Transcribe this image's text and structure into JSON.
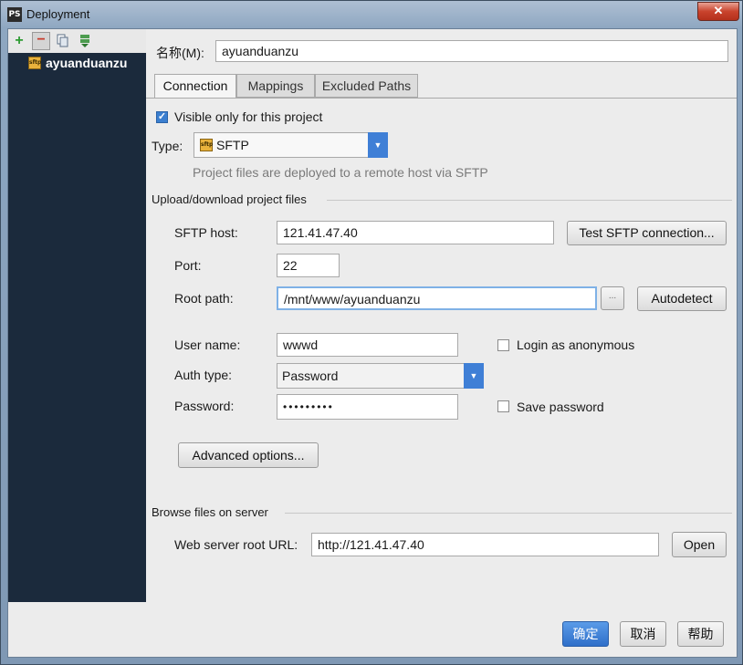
{
  "window": {
    "title": "Deployment",
    "app_icon": "PS",
    "close": "✕"
  },
  "sidebar": {
    "toolbar": {
      "add": "+",
      "remove": "−"
    },
    "servers": [
      {
        "label": "ayuanduanzu",
        "badge": "sftp"
      }
    ]
  },
  "main": {
    "name_label": "名称(M):",
    "name_value": "ayuanduanzu",
    "tabs": [
      {
        "label": "Connection"
      },
      {
        "label": "Mappings"
      },
      {
        "label": "Excluded Paths"
      }
    ],
    "visible_only_label": "Visible only for this project",
    "visible_only_checked": true,
    "type_label": "Type:",
    "type_value": "SFTP",
    "type_badge": "sftp",
    "type_hint": "Project files are deployed to a remote host via SFTP",
    "upload_section": "Upload/download project files",
    "sftp_host_label": "SFTP host:",
    "sftp_host_value": "121.41.47.40",
    "test_button": "Test SFTP connection...",
    "port_label": "Port:",
    "port_value": "22",
    "root_path_label": "Root path:",
    "root_path_value": "/mnt/www/ayuanduanzu",
    "browse_button": "...",
    "autodetect_button": "Autodetect",
    "user_name_label": "User name:",
    "user_name_value": "wwwd",
    "login_anon_label": "Login as anonymous",
    "auth_type_label": "Auth type:",
    "auth_type_value": "Password",
    "password_label": "Password:",
    "password_value": "•••••••••",
    "save_password_label": "Save password",
    "advanced_button": "Advanced options...",
    "browse_section": "Browse files on server",
    "web_root_label": "Web server root URL:",
    "web_root_value": "http://121.41.47.40",
    "open_button": "Open"
  },
  "footer": {
    "ok": "确定",
    "cancel": "取消",
    "help": "帮助"
  },
  "colors": {
    "sidebar_bg": "#1b2a3c",
    "accent": "#3f7fd6"
  }
}
